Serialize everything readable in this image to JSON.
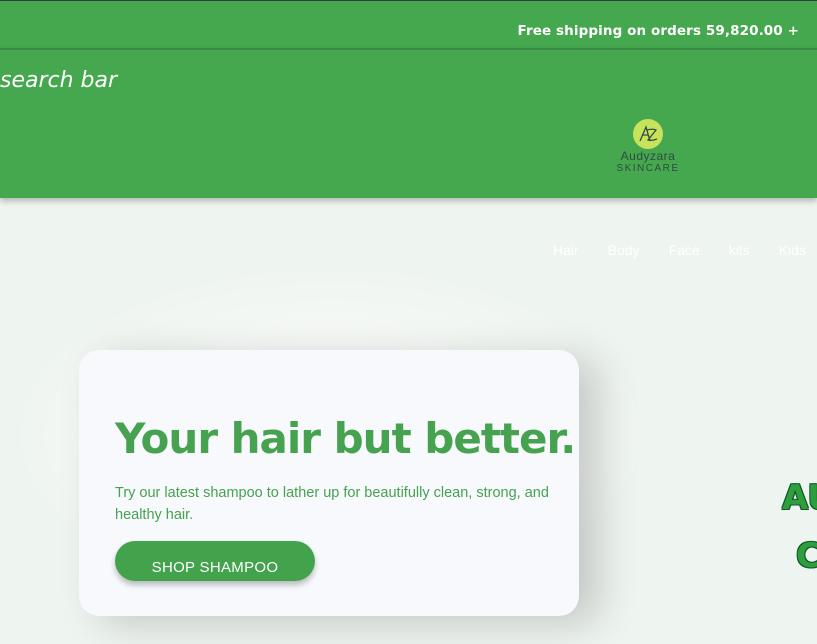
{
  "promo": {
    "text": "Free shipping on orders 59,820.00 +"
  },
  "header": {
    "search_label": "search bar",
    "logo": {
      "monogram": "AZ",
      "name": "Audyzara",
      "tagline": "SKINCARE",
      "badge_color": "#c6e35b"
    }
  },
  "nav": {
    "items": [
      {
        "label": "Hair"
      },
      {
        "label": "Body"
      },
      {
        "label": "Face"
      },
      {
        "label": "kits"
      },
      {
        "label": "Kids"
      }
    ]
  },
  "hero": {
    "title": "Your hair but better.",
    "description": "Try our latest shampoo to lather up for beautifully clean, strong, and healthy hair.",
    "button_label": "SHOP SHAMPOO"
  },
  "side_brand": {
    "line1": "AU",
    "line2": "C"
  },
  "colors": {
    "brand_green": "#45a84f",
    "accent_green": "#46a24f",
    "page_bg": "#eef4ef",
    "card_bg": "#f7f9fd"
  }
}
